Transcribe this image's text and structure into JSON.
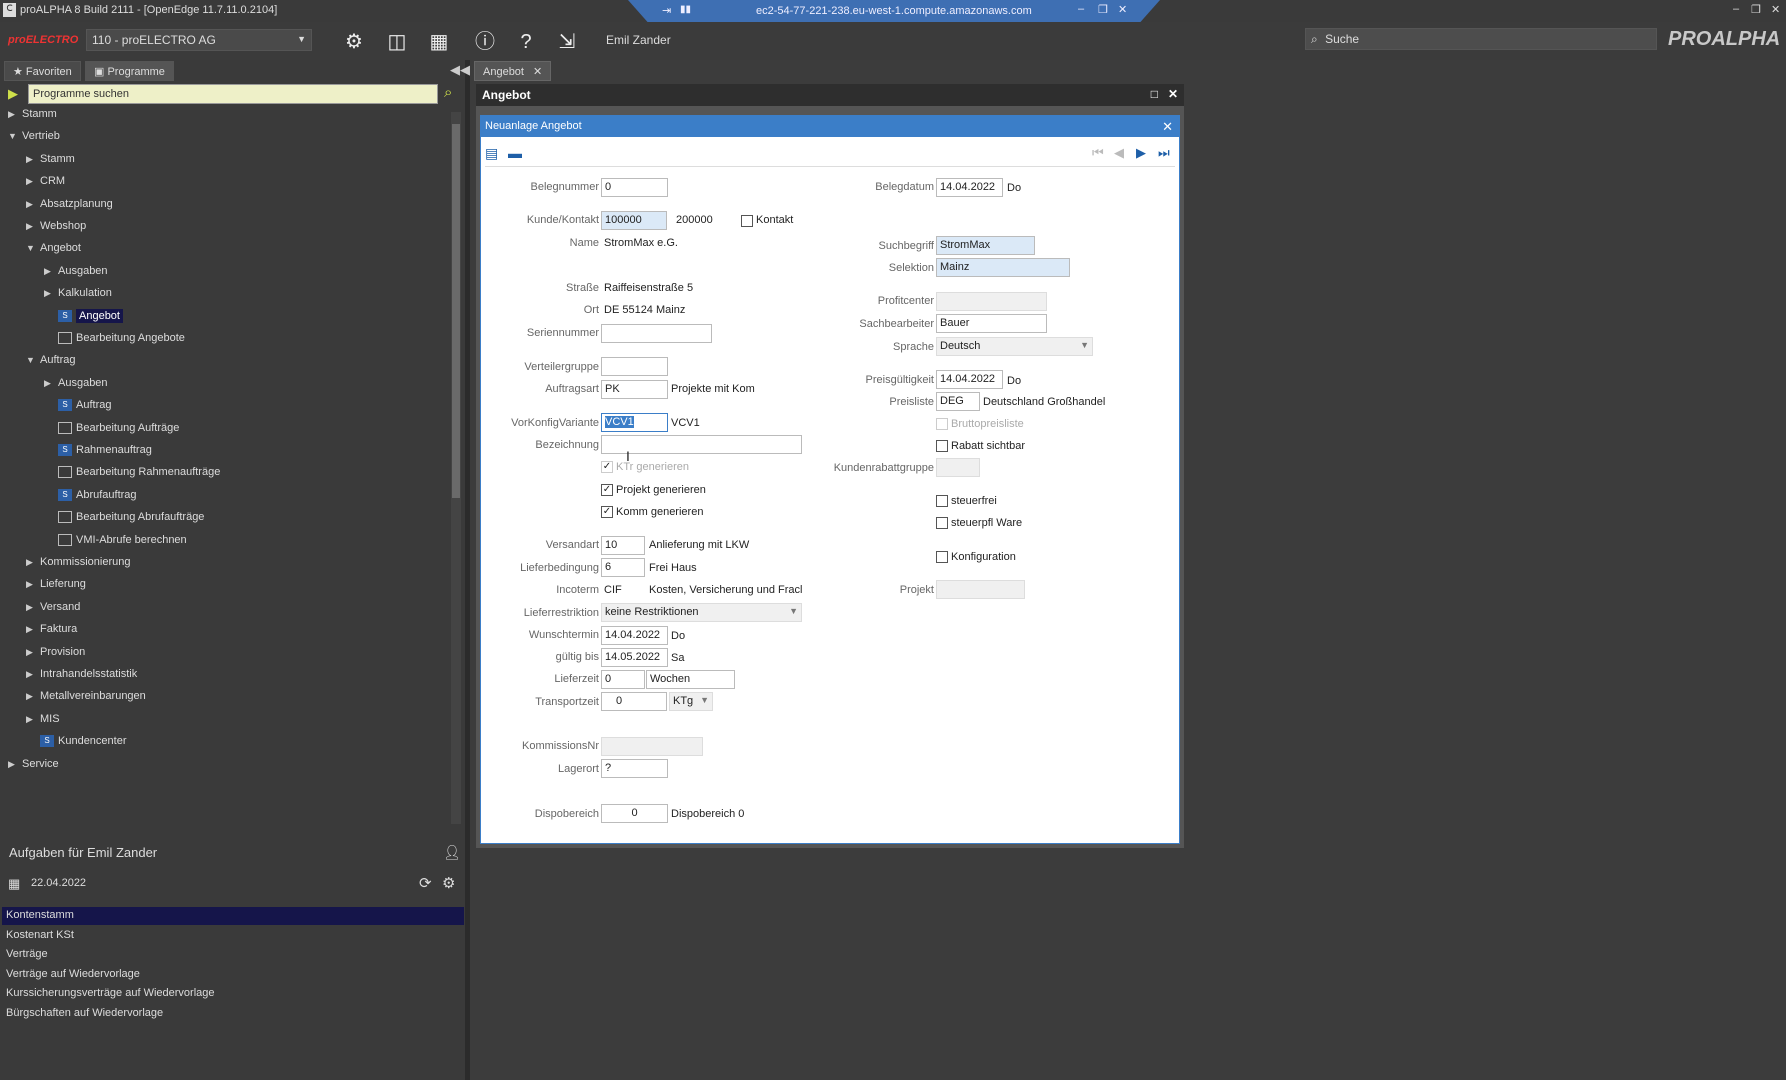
{
  "titlebar": {
    "title": "proALPHA 8 Build 2111 - [OpenEdge 11.7.11.0.2104]",
    "remote_host": "ec2-54-77-221-238.eu-west-1.compute.amazonaws.com"
  },
  "toolbar": {
    "company": "110 - proELECTRO AG",
    "user": "Emil Zander",
    "search_placeholder": "Suche",
    "brand": "PROALPHA",
    "logo_text": "proELECTRO"
  },
  "left_tabs": {
    "favorites": "Favoriten",
    "programs": "Programme"
  },
  "program_search": "Programme suchen",
  "tree": [
    {
      "label": "Stamm",
      "level": 0,
      "arrow": "right"
    },
    {
      "label": "Vertrieb",
      "level": 0,
      "arrow": "down"
    },
    {
      "label": "Stamm",
      "level": 1,
      "arrow": "right"
    },
    {
      "label": "CRM",
      "level": 1,
      "arrow": "right"
    },
    {
      "label": "Absatzplanung",
      "level": 1,
      "arrow": "right"
    },
    {
      "label": "Webshop",
      "level": 1,
      "arrow": "right"
    },
    {
      "label": "Angebot",
      "level": 1,
      "arrow": "down"
    },
    {
      "label": "Ausgaben",
      "level": 2,
      "arrow": "right"
    },
    {
      "label": "Kalkulation",
      "level": 2,
      "arrow": "right"
    },
    {
      "label": "Angebot",
      "level": 2,
      "icon": "S",
      "selected": true
    },
    {
      "label": "Bearbeitung Angebote",
      "level": 2,
      "icon": "grid"
    },
    {
      "label": "Auftrag",
      "level": 1,
      "arrow": "down"
    },
    {
      "label": "Ausgaben",
      "level": 2,
      "arrow": "right"
    },
    {
      "label": "Auftrag",
      "level": 2,
      "icon": "S"
    },
    {
      "label": "Bearbeitung Aufträge",
      "level": 2,
      "icon": "grid"
    },
    {
      "label": "Rahmenauftrag",
      "level": 2,
      "icon": "S"
    },
    {
      "label": "Bearbeitung Rahmenaufträge",
      "level": 2,
      "icon": "grid"
    },
    {
      "label": "Abrufauftrag",
      "level": 2,
      "icon": "S"
    },
    {
      "label": "Bearbeitung Abrufaufträge",
      "level": 2,
      "icon": "grid"
    },
    {
      "label": "VMI-Abrufe berechnen",
      "level": 2,
      "icon": "grid"
    },
    {
      "label": "Kommissionierung",
      "level": 1,
      "arrow": "right"
    },
    {
      "label": "Lieferung",
      "level": 1,
      "arrow": "right"
    },
    {
      "label": "Versand",
      "level": 1,
      "arrow": "right"
    },
    {
      "label": "Faktura",
      "level": 1,
      "arrow": "right"
    },
    {
      "label": "Provision",
      "level": 1,
      "arrow": "right"
    },
    {
      "label": "Intrahandelsstatistik",
      "level": 1,
      "arrow": "right"
    },
    {
      "label": "Metallvereinbarungen",
      "level": 1,
      "arrow": "right"
    },
    {
      "label": "MIS",
      "level": 1,
      "arrow": "right"
    },
    {
      "label": "Kundencenter",
      "level": 1,
      "icon": "S"
    },
    {
      "label": "Service",
      "level": 0,
      "arrow": "right"
    }
  ],
  "tasks": {
    "title": "Aufgaben für Emil Zander",
    "date": "22.04.2022",
    "items": [
      "Kontenstamm",
      "Kostenart KSt",
      "Verträge",
      "Verträge auf Wiedervorlage",
      "Kurssicherungsverträge auf Wiedervorlage",
      "Bürgschaften auf Wiedervorlage"
    ]
  },
  "doc_tab": "Angebot",
  "window_title": "Angebot",
  "dialog_title": "Neuanlage Angebot",
  "form": {
    "belegnummer_label": "Belegnummer",
    "belegnummer": "0",
    "kunde_label": "Kunde/Kontakt",
    "kunde": "100000",
    "kontakt_nr": "200000",
    "kontakt_label": "Kontakt",
    "name_label": "Name",
    "name": "StromMax e.G.",
    "strasse_label": "Straße",
    "strasse": "Raiffeisenstraße 5",
    "ort_label": "Ort",
    "ort": "DE 55124 Mainz",
    "seriennummer_label": "Seriennummer",
    "verteilergruppe_label": "Verteilergruppe",
    "auftragsart_label": "Auftragsart",
    "auftragsart": "PK",
    "auftragsart_text": "Projekte mit Kom",
    "vorkonfig_label": "VorKonfigVariante",
    "vorkonfig": "VCV1",
    "vorkonfig_text": "VCV1",
    "bezeichnung_label": "Bezeichnung",
    "ktr_label": "KTr generieren",
    "projekt_gen_label": "Projekt generieren",
    "komm_gen_label": "Komm generieren",
    "versandart_label": "Versandart",
    "versandart": "10",
    "versandart_text": "Anlieferung mit LKW",
    "lieferbed_label": "Lieferbedingung",
    "lieferbed": "6",
    "lieferbed_text": "Frei Haus",
    "incoterm_label": "Incoterm",
    "incoterm": "CIF",
    "incoterm_text": "Kosten, Versicherung und Fracl",
    "lieferrestr_label": "Lieferrestriktion",
    "lieferrestr": "keine Restriktionen",
    "wunschtermin_label": "Wunschtermin",
    "wunschtermin": "14.04.2022",
    "wunschtermin_day": "Do",
    "gueltig_label": "gültig bis",
    "gueltig": "14.05.2022",
    "gueltig_day": "Sa",
    "lieferzeit_label": "Lieferzeit",
    "lieferzeit": "0",
    "lieferzeit_unit": "Wochen",
    "transportzeit_label": "Transportzeit",
    "transportzeit": "0",
    "transportzeit_unit": "KTg",
    "kommissionsnr_label": "KommissionsNr",
    "lagerort_label": "Lagerort",
    "lagerort": "?",
    "dispobereich_label": "Dispobereich",
    "dispobereich": "0",
    "dispobereich_text": "Dispobereich 0",
    "belegdatum_label": "Belegdatum",
    "belegdatum": "14.04.2022",
    "belegdatum_day": "Do",
    "suchbegriff_label": "Suchbegriff",
    "suchbegriff": "StromMax",
    "selektion_label": "Selektion",
    "selektion": "Mainz",
    "profitcenter_label": "Profitcenter",
    "sachbearbeiter_label": "Sachbearbeiter",
    "sachbearbeiter": "Bauer",
    "sprache_label": "Sprache",
    "sprache": "Deutsch",
    "preisgueltig_label": "Preisgültigkeit",
    "preisgueltig": "14.04.2022",
    "preisgueltig_day": "Do",
    "preisliste_label": "Preisliste",
    "preisliste": "DEG",
    "preisliste_text": "Deutschland Großhandel",
    "brutto_label": "Bruttopreisliste",
    "rabatt_label": "Rabatt sichtbar",
    "kundenrabatt_label": "Kundenrabattgruppe",
    "steuerfrei_label": "steuerfrei",
    "steuerpfl_label": "steuerpfl Ware",
    "konfiguration_label": "Konfiguration",
    "projekt_label": "Projekt"
  }
}
